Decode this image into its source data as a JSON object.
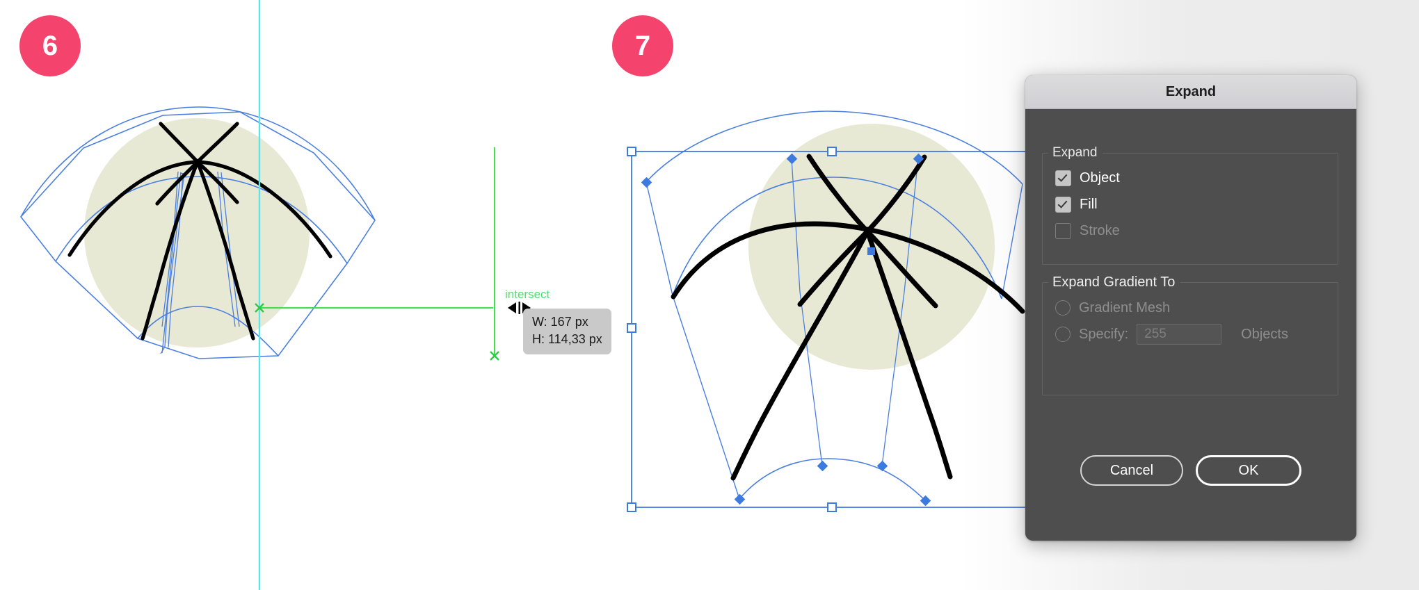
{
  "steps": [
    {
      "number": "6"
    },
    {
      "number": "7"
    }
  ],
  "canvas": {
    "smart_guide_label": "intersect",
    "measurement": {
      "width_text": "W: 167 px",
      "height_text": "H: 114,33 px"
    },
    "colors": {
      "badge": "#f4436c",
      "selection_blue": "#3d7ae0",
      "path_blue": "#4a7fe0",
      "shape_fill_olive": "#e8e9d4",
      "stroke_black": "#000000",
      "guide_cyan": "#5fe3e8",
      "smart_guide_green": "#4fe06a",
      "tooltip_bg": "#c9c9c9"
    }
  },
  "dialog": {
    "title": "Expand",
    "expand_group": {
      "legend": "Expand",
      "options": [
        {
          "label": "Object",
          "checked": true,
          "enabled": true
        },
        {
          "label": "Fill",
          "checked": true,
          "enabled": true
        },
        {
          "label": "Stroke",
          "checked": false,
          "enabled": false
        }
      ]
    },
    "gradient_group": {
      "legend": "Expand Gradient To",
      "options": [
        {
          "label": "Gradient Mesh",
          "selected": false,
          "enabled": false
        },
        {
          "label": "Specify:",
          "selected": false,
          "enabled": false
        }
      ],
      "specify_value": "255",
      "objects_label": "Objects"
    },
    "buttons": {
      "cancel": "Cancel",
      "ok": "OK"
    }
  }
}
